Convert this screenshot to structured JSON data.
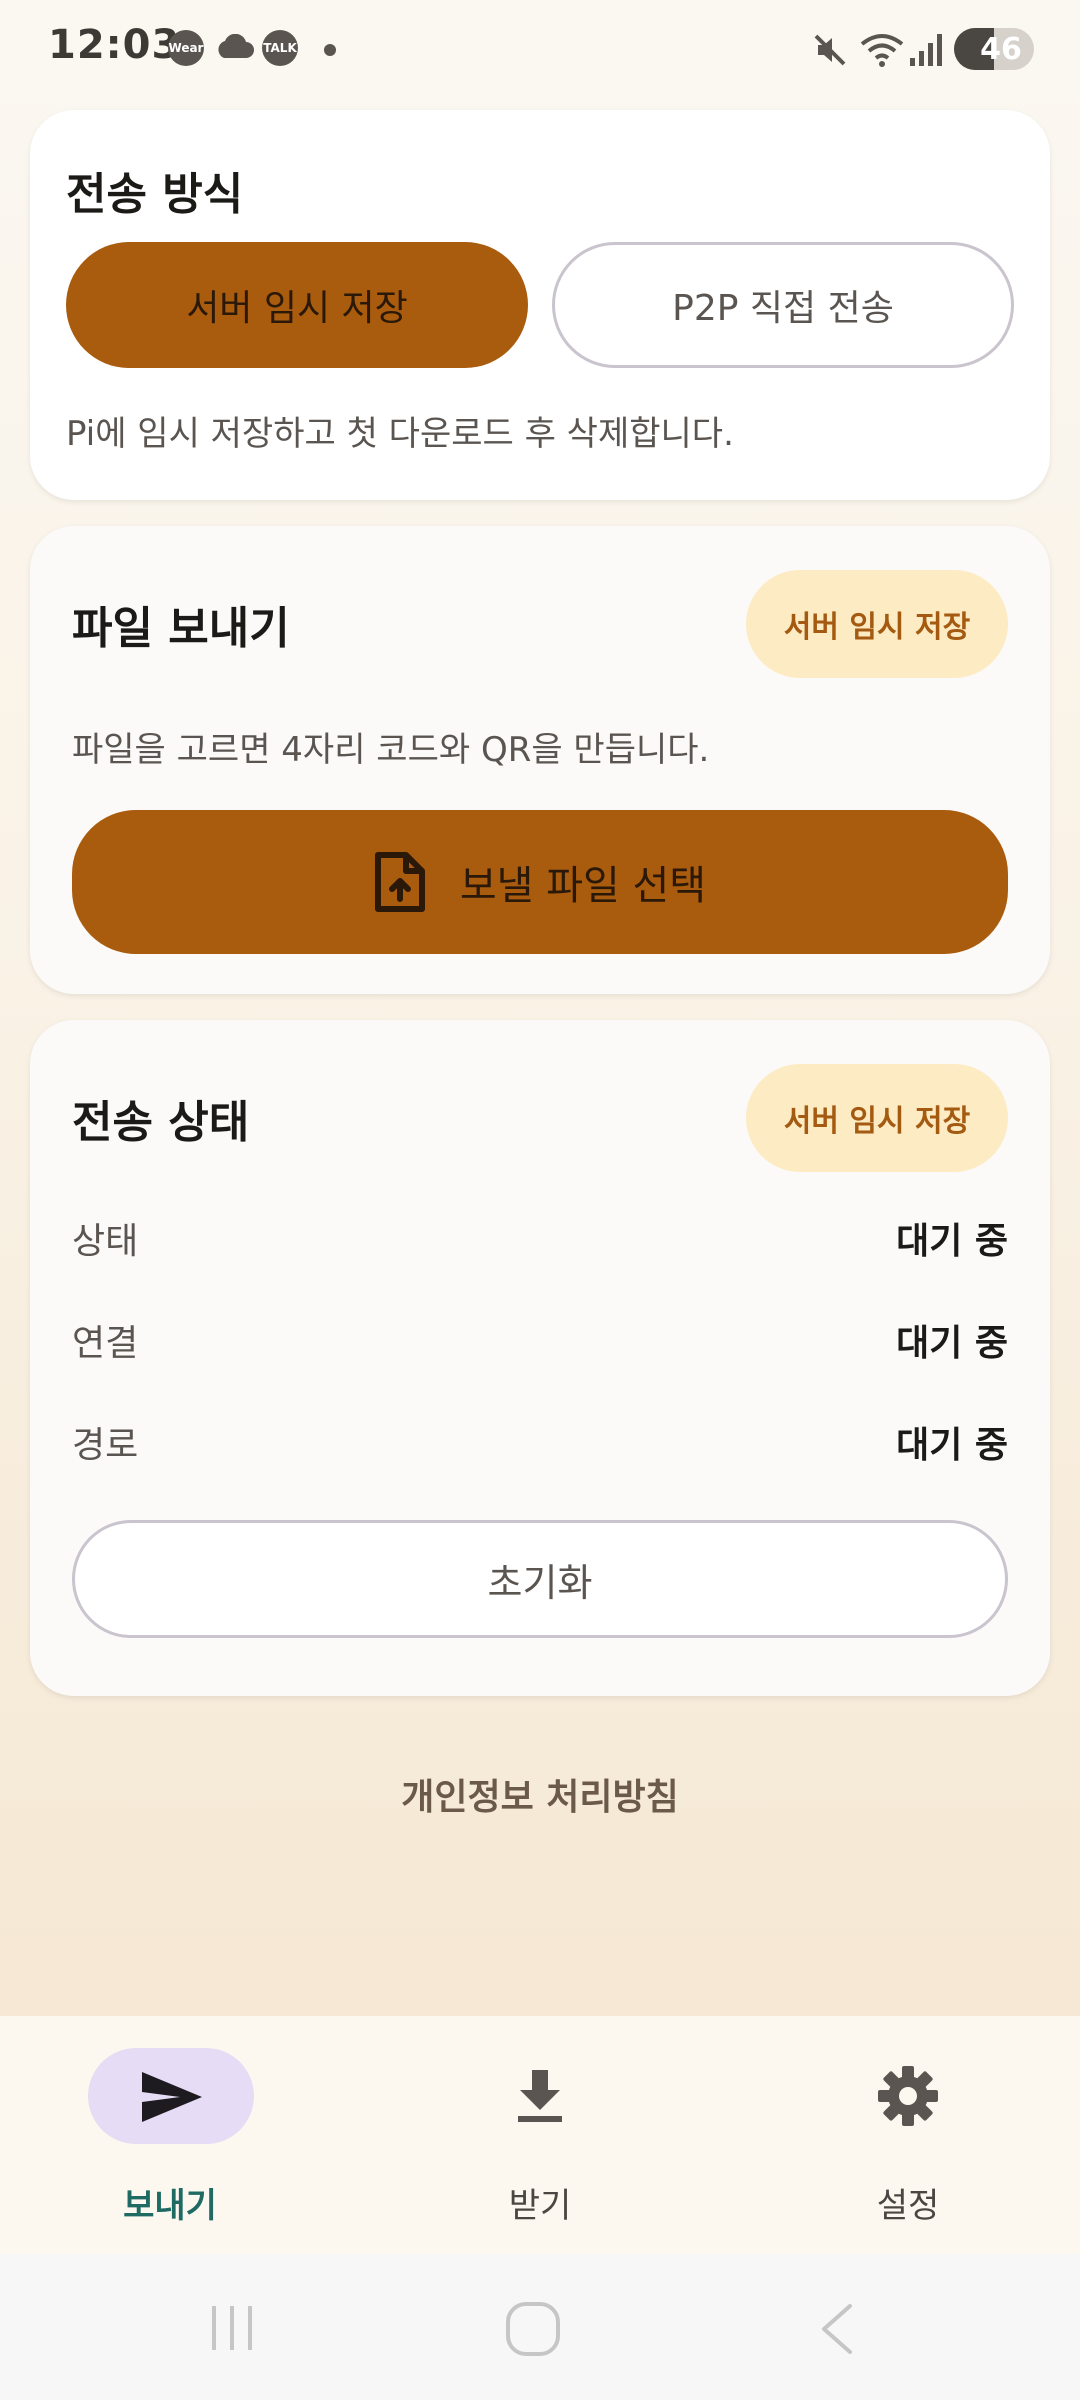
{
  "status_bar": {
    "time": "12:03",
    "notification_icons": [
      "Wear",
      "cloud-icon",
      "TALK"
    ],
    "battery": "46"
  },
  "transfer_method": {
    "title": "전송 방식",
    "options": [
      "서버 임시 저장",
      "P2P 직접 전송"
    ],
    "selected": "서버 임시 저장",
    "description": "Pi에 임시 저장하고 첫 다운로드 후 삭제합니다."
  },
  "send_file": {
    "title": "파일 보내기",
    "badge": "서버 임시 저장",
    "description": "파일을 고르면 4자리 코드와 QR을 만듭니다.",
    "select_button": "보낼 파일 선택"
  },
  "transfer_status": {
    "title": "전송 상태",
    "badge": "서버 임시 저장",
    "rows": [
      {
        "label": "상태",
        "value": "대기 중"
      },
      {
        "label": "연결",
        "value": "대기 중"
      },
      {
        "label": "경로",
        "value": "대기 중"
      }
    ],
    "reset_button": "초기화"
  },
  "privacy_link": "개인정보 처리방침",
  "bottom_nav": {
    "items": [
      {
        "label": "보내기",
        "icon": "send-icon",
        "active": true
      },
      {
        "label": "받기",
        "icon": "download-icon",
        "active": false
      },
      {
        "label": "설정",
        "icon": "gear-icon",
        "active": false
      }
    ]
  },
  "colors": {
    "accent": "#a95b0e",
    "badge_bg": "#fdebc4",
    "active_nav_pill": "#e6dcf5",
    "active_nav_label": "#1f6b63"
  }
}
